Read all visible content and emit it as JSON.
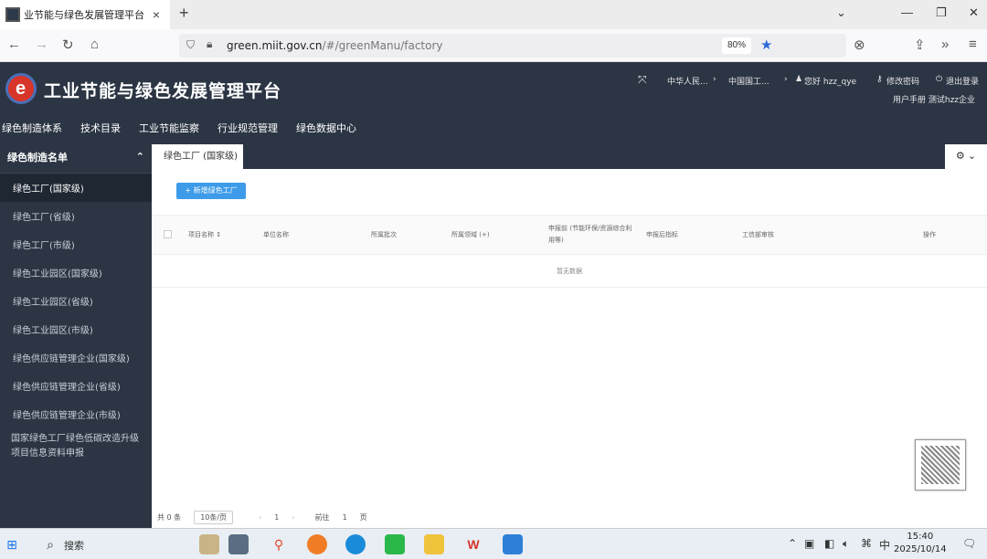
{
  "browser": {
    "tab_title": "业节能与绿色发展管理平台 |",
    "tab_close": "×",
    "new_tab": "+",
    "url_host": "green.miit.gov.cn",
    "url_path": "/#/greenManu/factory",
    "zoom": "80%"
  },
  "app": {
    "title": "工业节能与绿色发展管理平台",
    "header_right": {
      "org1": "中华人民...",
      "org2": "中国国工...",
      "user": "您好 hzz_qye",
      "change_password": "修改密码",
      "logout": "退出登录",
      "user_line": "用户手册  测试hzz企业"
    },
    "topnav": [
      "绿色制造体系",
      "技术目录",
      "工业节能监察",
      "行业规范管理",
      "绿色数据中心"
    ]
  },
  "sidebar": {
    "header": "绿色制造名单",
    "items": [
      "绿色工厂(国家级)",
      "绿色工厂(省级)",
      "绿色工厂(市级)",
      "绿色工业园区(国家级)",
      "绿色工业园区(省级)",
      "绿色工业园区(市级)",
      "绿色供应链管理企业(国家级)",
      "绿色供应链管理企业(省级)",
      "绿色供应链管理企业(市级)",
      "国家绿色工厂绿色低碳改造升级项目信息资料申报"
    ]
  },
  "main": {
    "page_tab": "绿色工厂 (国家级)",
    "add_button": "+ 新增绿色工厂",
    "columns": [
      "项目名称 ↕",
      "单位名称",
      "所属批次",
      "所属领域 (+)",
      "申报前 (节能环保/资源综合利用等)",
      "申报后指标",
      "工信部审核",
      "操作"
    ],
    "empty_text": "暂无数据",
    "pager": {
      "total": "共 0 条",
      "page_size": "10条/页",
      "prev": "‹",
      "page": "1",
      "next": "›",
      "goto": "前往",
      "goto_page": "1",
      "goto_suffix": "页"
    }
  },
  "taskbar": {
    "search": "搜索",
    "time": "15:40",
    "date": "2025/10/14"
  }
}
